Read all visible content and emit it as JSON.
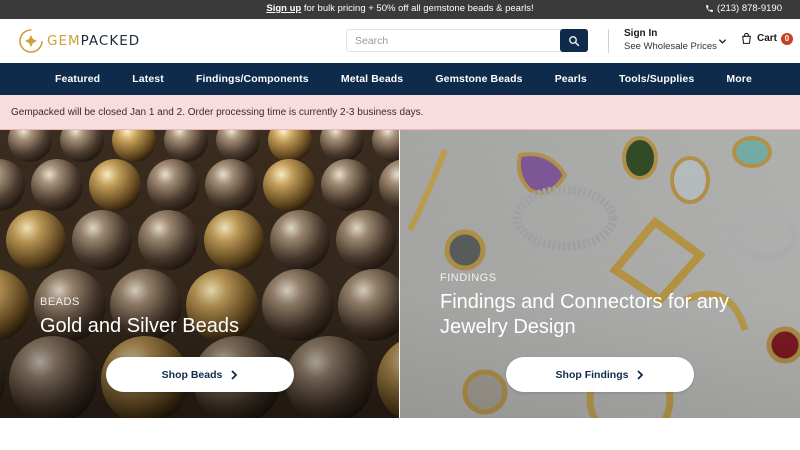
{
  "promo": {
    "link_text": "Sign up",
    "text": " for bulk pricing + 50% off all gemstone beads & pearls!",
    "phone": "(213) 878-9190"
  },
  "header": {
    "logo_gem": "GEM",
    "logo_packed": "PACKED",
    "search_placeholder": "Search",
    "signin_line1": "Sign In",
    "signin_line2": "See Wholesale Prices",
    "cart_label": "Cart",
    "cart_count": "0"
  },
  "nav": {
    "items": [
      {
        "label": "Featured"
      },
      {
        "label": "Latest"
      },
      {
        "label": "Findings/Components"
      },
      {
        "label": "Metal Beads"
      },
      {
        "label": "Gemstone Beads"
      },
      {
        "label": "Pearls"
      },
      {
        "label": "Tools/Supplies"
      },
      {
        "label": "More"
      }
    ]
  },
  "notice": {
    "text": "Gempacked will be closed Jan 1 and 2. Order processing time is currently 2-3 business days."
  },
  "hero": {
    "left": {
      "eyebrow": "BEADS",
      "headline": "Gold and Silver Beads",
      "button": "Shop Beads"
    },
    "right": {
      "eyebrow": "FINDINGS",
      "headline": "Findings and Connectors for any Jewelry Design",
      "button": "Shop Findings"
    }
  },
  "colors": {
    "navy": "#0f2b4c",
    "promo_bg": "#3a3a3a",
    "notice_bg": "#f8dde0",
    "badge": "#c8401d",
    "logo_gold": "#c9a23a"
  }
}
